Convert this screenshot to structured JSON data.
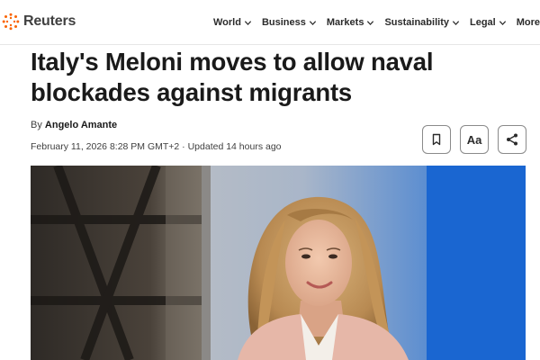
{
  "brand": {
    "name": "Reuters",
    "logo_icon": "reuters-dots-icon",
    "accent": "#fa6400"
  },
  "nav": {
    "items": [
      {
        "label": "World",
        "has_menu": true
      },
      {
        "label": "Business",
        "has_menu": true
      },
      {
        "label": "Markets",
        "has_menu": true
      },
      {
        "label": "Sustainability",
        "has_menu": true
      },
      {
        "label": "Legal",
        "has_menu": true
      },
      {
        "label": "More",
        "has_menu": false
      }
    ]
  },
  "article": {
    "headline_line1": "Italy's Meloni moves to allow naval",
    "headline_line2": "blockades against migrants",
    "byline_prefix": "By",
    "author": "Angelo Amante",
    "dateline": "February 11, 2026 8:28 PM GMT+2 · Updated 14 hours ago"
  },
  "actions": {
    "bookmark_icon": "bookmark-icon",
    "text_size_label": "Aa",
    "share_icon": "share-icon"
  },
  "photo": {
    "subject": "lead-photo"
  }
}
